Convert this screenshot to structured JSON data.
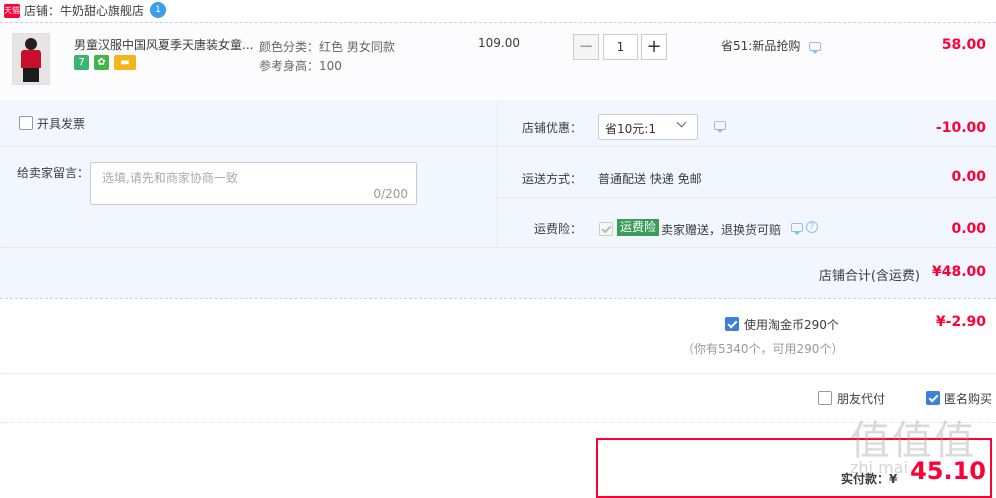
{
  "shop": {
    "badge": "天猫",
    "label": "店铺：牛奶甜心旗舰店",
    "wangwang_badge": "1"
  },
  "item": {
    "title": "男童汉服中国风夏季天唐装女童...",
    "service_icons": [
      "7",
      "✿",
      "▬"
    ],
    "sku_color": "颜色分类：红色 男女同款",
    "sku_height": "参考身高：100",
    "price": "109.00",
    "qty_minus": "−",
    "qty": "1",
    "qty_plus": "+",
    "promo": "省51:新品抢购",
    "total": "58.00"
  },
  "order": {
    "invoice_label": "开具发票",
    "memo_label": "给卖家留言：",
    "memo_placeholder": "选填,请先和商家协商一致",
    "memo_count": "0/200",
    "coupon_label": "店铺优惠：",
    "coupon_selected": "省10元:1",
    "coupon_value": "-10.00",
    "shipping_label": "运送方式：",
    "shipping_method": "普通配送 快递 免邮",
    "shipping_value": "0.00",
    "insurance_label": "运费险：",
    "insurance_badge": "运费险",
    "insurance_text": "卖家赠送，退换货可赔",
    "insurance_value": "0.00",
    "help_glyph": "?",
    "subtotal_label": "店铺合计(含运费)",
    "subtotal_value": "¥48.00"
  },
  "coins": {
    "label": "使用淘金币290个",
    "note": "（你有5340个，可用290个）",
    "value": "¥-2.90"
  },
  "options": {
    "friend_pay": "朋友代付",
    "anonymous": "匿名购买"
  },
  "pay": {
    "label": "实付款：¥",
    "value": "45.10"
  },
  "watermark": {
    "chars": "值值值",
    "url": "zhi mai"
  },
  "colors": {
    "accent": "#ff0036",
    "panel": "#f2f7ff",
    "checkbox": "#3e7fd9",
    "insurance_badge": "#3a9e59"
  }
}
